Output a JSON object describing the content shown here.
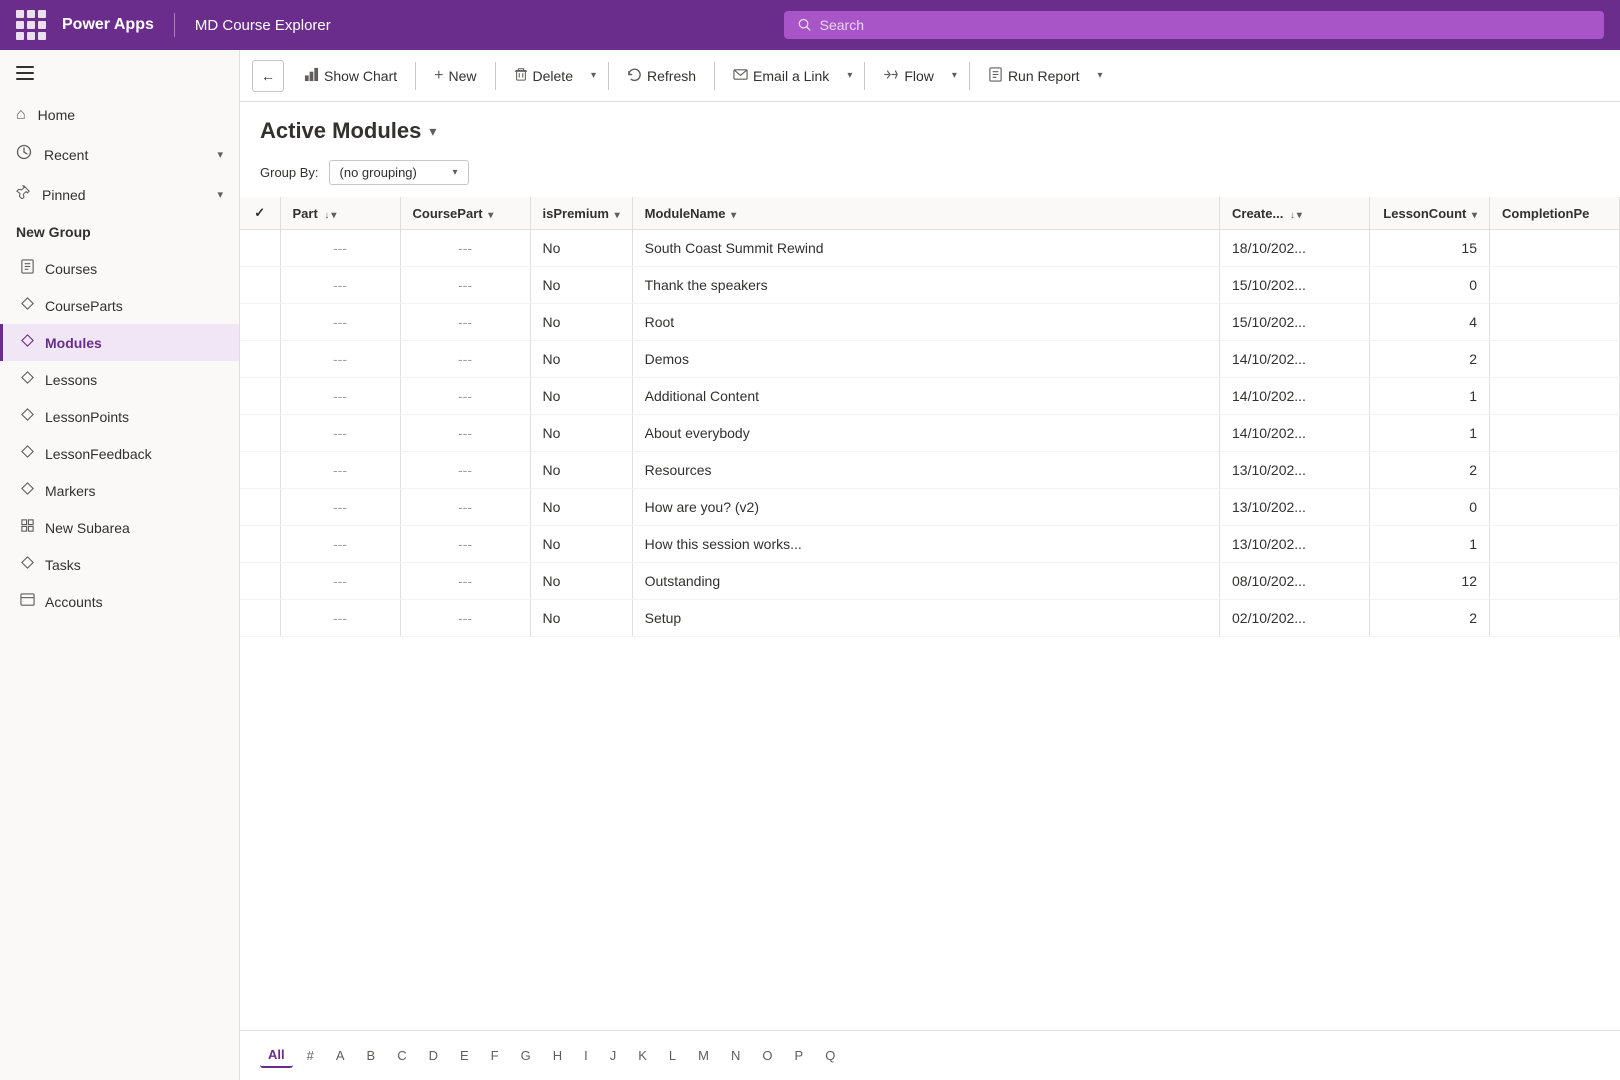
{
  "topbar": {
    "logo": "Power Apps",
    "appname": "MD Course Explorer",
    "search_placeholder": "Search"
  },
  "sidebar": {
    "nav_items": [
      {
        "id": "home",
        "label": "Home",
        "icon": "⌂"
      },
      {
        "id": "recent",
        "label": "Recent",
        "icon": "🕐",
        "has_chevron": true
      },
      {
        "id": "pinned",
        "label": "Pinned",
        "icon": "📌",
        "has_chevron": true
      }
    ],
    "new_group_label": "New Group",
    "items": [
      {
        "id": "courses",
        "label": "Courses",
        "icon": "📚",
        "active": false
      },
      {
        "id": "courseparts",
        "label": "CourseParts",
        "icon": "🧩",
        "active": false
      },
      {
        "id": "modules",
        "label": "Modules",
        "icon": "🧩",
        "active": true
      },
      {
        "id": "lessons",
        "label": "Lessons",
        "icon": "🧩",
        "active": false
      },
      {
        "id": "lessonpoints",
        "label": "LessonPoints",
        "icon": "🧩",
        "active": false
      },
      {
        "id": "lessonfeedback",
        "label": "LessonFeedback",
        "icon": "🧩",
        "active": false
      },
      {
        "id": "markers",
        "label": "Markers",
        "icon": "🧩",
        "active": false
      },
      {
        "id": "newsubarea",
        "label": "New Subarea",
        "icon": "⊞",
        "active": false
      },
      {
        "id": "tasks",
        "label": "Tasks",
        "icon": "🧩",
        "active": false
      },
      {
        "id": "accounts",
        "label": "Accounts",
        "icon": "🗒",
        "active": false
      }
    ]
  },
  "toolbar": {
    "back_label": "←",
    "show_chart_label": "Show Chart",
    "new_label": "New",
    "delete_label": "Delete",
    "refresh_label": "Refresh",
    "email_link_label": "Email a Link",
    "flow_label": "Flow",
    "run_report_label": "Run Report"
  },
  "page": {
    "title": "Active Modules",
    "groupby_label": "Group By:",
    "groupby_value": "(no grouping)"
  },
  "table": {
    "columns": [
      {
        "id": "check",
        "label": "✓",
        "sortable": false
      },
      {
        "id": "part",
        "label": "Part",
        "sortable": true,
        "filterable": true
      },
      {
        "id": "coursepart",
        "label": "CoursePart",
        "sortable": true,
        "filterable": true
      },
      {
        "id": "ispremium",
        "label": "isPremium",
        "sortable": true,
        "filterable": true
      },
      {
        "id": "modulename",
        "label": "ModuleName",
        "sortable": true,
        "filterable": true
      },
      {
        "id": "created",
        "label": "Create...",
        "sortable": true,
        "filterable": true,
        "sort_dir": "desc"
      },
      {
        "id": "lessoncount",
        "label": "LessonCount",
        "sortable": true,
        "filterable": true
      },
      {
        "id": "completionpe",
        "label": "CompletionPe",
        "sortable": false
      }
    ],
    "rows": [
      {
        "part": "---",
        "coursepart": "---",
        "ispremium": "No",
        "modulename": "South Coast Summit Rewind",
        "created": "18/10/202...",
        "lessoncount": "15",
        "completionpe": ""
      },
      {
        "part": "---",
        "coursepart": "---",
        "ispremium": "No",
        "modulename": "Thank the speakers",
        "created": "15/10/202...",
        "lessoncount": "0",
        "completionpe": ""
      },
      {
        "part": "---",
        "coursepart": "---",
        "ispremium": "No",
        "modulename": "Root",
        "created": "15/10/202...",
        "lessoncount": "4",
        "completionpe": ""
      },
      {
        "part": "---",
        "coursepart": "---",
        "ispremium": "No",
        "modulename": "Demos",
        "created": "14/10/202...",
        "lessoncount": "2",
        "completionpe": ""
      },
      {
        "part": "---",
        "coursepart": "---",
        "ispremium": "No",
        "modulename": "Additional Content",
        "created": "14/10/202...",
        "lessoncount": "1",
        "completionpe": ""
      },
      {
        "part": "---",
        "coursepart": "---",
        "ispremium": "No",
        "modulename": "About everybody",
        "created": "14/10/202...",
        "lessoncount": "1",
        "completionpe": ""
      },
      {
        "part": "---",
        "coursepart": "---",
        "ispremium": "No",
        "modulename": "Resources",
        "created": "13/10/202...",
        "lessoncount": "2",
        "completionpe": ""
      },
      {
        "part": "---",
        "coursepart": "---",
        "ispremium": "No",
        "modulename": "How are you? (v2)",
        "created": "13/10/202...",
        "lessoncount": "0",
        "completionpe": ""
      },
      {
        "part": "---",
        "coursepart": "---",
        "ispremium": "No",
        "modulename": "How this session works...",
        "created": "13/10/202...",
        "lessoncount": "1",
        "completionpe": ""
      },
      {
        "part": "---",
        "coursepart": "---",
        "ispremium": "No",
        "modulename": "Outstanding",
        "created": "08/10/202...",
        "lessoncount": "12",
        "completionpe": ""
      },
      {
        "part": "---",
        "coursepart": "---",
        "ispremium": "No",
        "modulename": "Setup",
        "created": "02/10/202...",
        "lessoncount": "2",
        "completionpe": ""
      }
    ]
  },
  "pagination": {
    "letters": [
      "All",
      "#",
      "A",
      "B",
      "C",
      "D",
      "E",
      "F",
      "G",
      "H",
      "I",
      "J",
      "K",
      "L",
      "M",
      "N",
      "O",
      "P",
      "Q"
    ],
    "active": "All"
  }
}
